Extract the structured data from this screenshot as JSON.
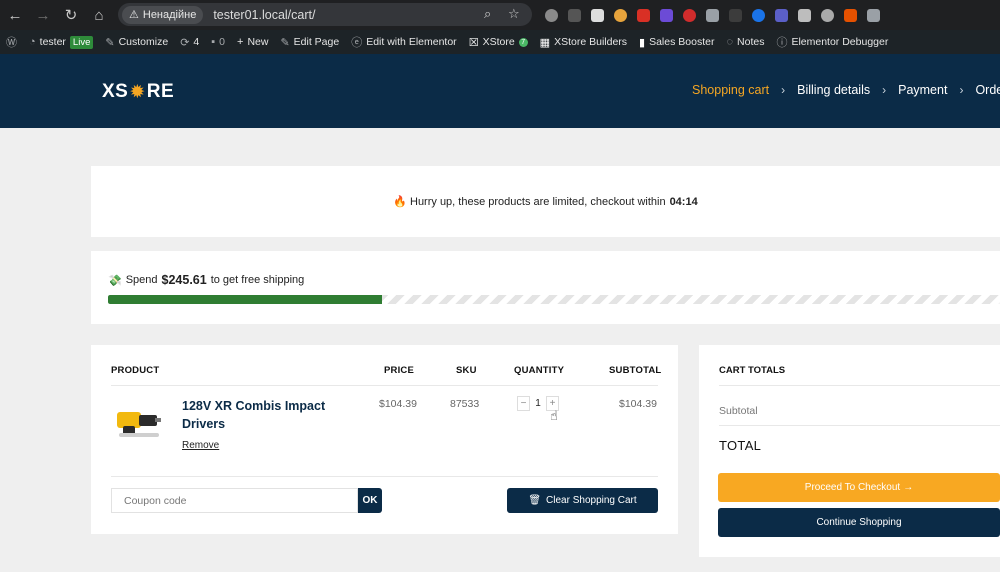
{
  "browser": {
    "security_label": "Ненадійне",
    "url": "tester01.local/cart/",
    "extension_colors": [
      "#8a8a8a",
      "#555555",
      "#dddddd",
      "#e7a33c",
      "#d93025",
      "#6c4bd6",
      "#d12c2c",
      "#9aa0a6",
      "#3c3c3c",
      "#1a73e8",
      "#5b5fc7",
      "#bdbdbd",
      "#aaaaaa",
      "#e65100",
      "#9aa0a6"
    ]
  },
  "wpbar": {
    "site": "tester",
    "live": "Live",
    "customize": "Customize",
    "updates": "4",
    "comments": "0",
    "new": "New",
    "edit_page": "Edit Page",
    "edit_elementor": "Edit with Elementor",
    "xstore": "XStore",
    "xstore_badge": "7",
    "builders": "XStore Builders",
    "sales_booster": "Sales Booster",
    "notes": "Notes",
    "debugger": "Elementor Debugger"
  },
  "header": {
    "logo_left": "XS",
    "logo_right": "RE",
    "steps": [
      "Shopping cart",
      "Billing details",
      "Payment",
      "Order"
    ],
    "accent_color": "#f5a623",
    "brand_color": "#0b2b47"
  },
  "hurry": {
    "text": "Hurry up, these products are limited, checkout within",
    "timer": "04:14"
  },
  "shipping": {
    "prefix": "Spend",
    "amount": "$245.61",
    "suffix": "to get free shipping",
    "progress_fraction": 0.307
  },
  "cart": {
    "headers": {
      "product": "PRODUCT",
      "price": "PRICE",
      "sku": "SKU",
      "quantity": "QUANTITY",
      "subtotal": "SUBTOTAL"
    },
    "item": {
      "name": "128V XR Combis Impact Drivers",
      "remove": "Remove",
      "price": "$104.39",
      "sku": "87533",
      "quantity": "1",
      "subtotal": "$104.39"
    },
    "coupon_placeholder": "Coupon code",
    "ok": "OK",
    "clear": "Clear Shopping Cart"
  },
  "totals": {
    "title": "CART TOTALS",
    "subtotal_label": "Subtotal",
    "total_label": "TOTAL",
    "checkout": "Proceed To Checkout",
    "continue": "Continue Shopping"
  }
}
